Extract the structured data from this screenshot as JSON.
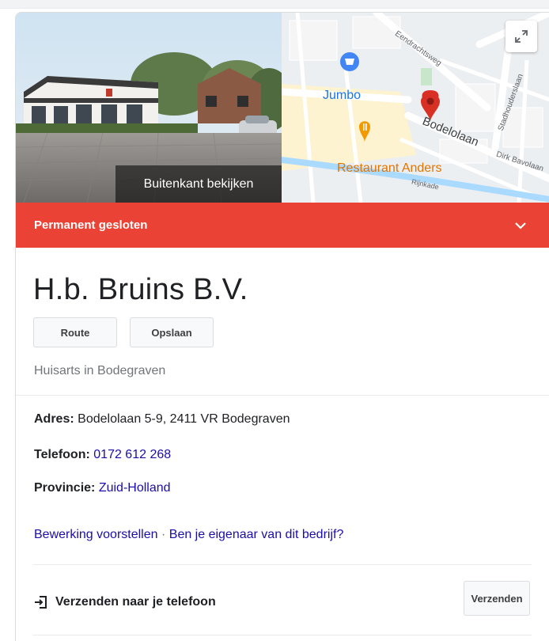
{
  "media": {
    "photo_caption": "Buitenkant bekijken",
    "map_labels": {
      "jumbo": "Jumbo",
      "restaurant": "Restaurant Anders",
      "street_eendrachtsweg": "Eendrachtsweg",
      "street_bodelolaan": "Bodelolaan",
      "street_stadhouderslaan": "Stadhouderslaan",
      "street_dirk_bavolaan": "Dirk Bavolaan",
      "street_rijnkade": "Rijnkade"
    },
    "expand_icon": "expand-icon"
  },
  "banner": {
    "text": "Permanent gesloten",
    "color": "#ea4335"
  },
  "business": {
    "name": "H.b. Bruins B.V.",
    "category": "Huisarts in Bodegraven"
  },
  "actions": {
    "route_label": "Route",
    "save_label": "Opslaan"
  },
  "info": {
    "address_label": "Adres:",
    "address_value": "Bodelolaan 5-9, 2411 VR Bodegraven",
    "phone_label": "Telefoon:",
    "phone_value": "0172 612 268",
    "province_label": "Provincie:",
    "province_value": "Zuid-Holland"
  },
  "edit": {
    "suggest_label": "Bewerking voorstellen",
    "separator": "·",
    "owner_label": "Ben je eigenaar van dit bedrijf?"
  },
  "send": {
    "label": "Verzenden naar je telefoon",
    "button_label": "Verzenden"
  },
  "colors": {
    "link": "#1a0dab",
    "banner": "#ea4335",
    "map_pin": "#d93025"
  }
}
